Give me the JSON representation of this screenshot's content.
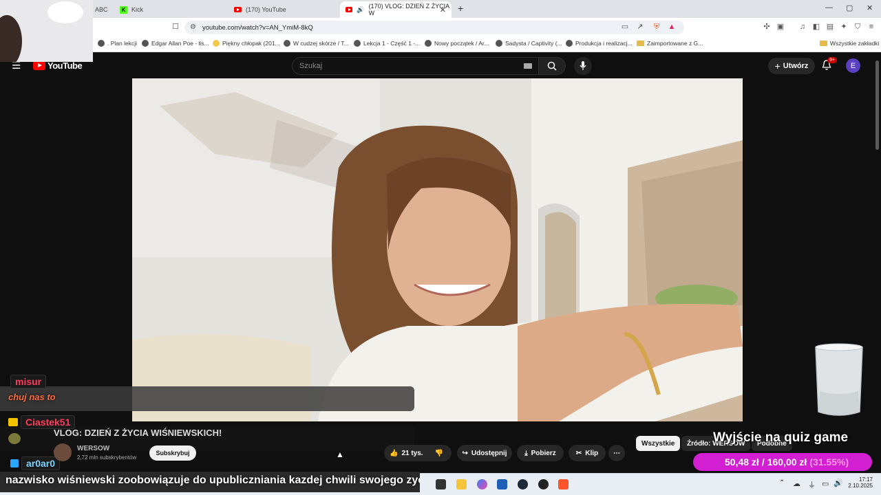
{
  "tabs": [
    {
      "label": "ABC",
      "favicon": "tab-icon"
    },
    {
      "label": "Kick",
      "favicon": "kick-icon"
    },
    {
      "label": "(170) YouTube",
      "favicon": "youtube-icon"
    },
    {
      "label": "(170) VLOG: DZIEŃ Z ŻYCIA W",
      "favicon": "youtube-icon"
    }
  ],
  "new_tab": "+",
  "window_controls": {
    "minimize": "—",
    "maximize": "▢",
    "close": "✕"
  },
  "address": {
    "url": "youtube.com/watch?v=AN_YmiM-8kQ"
  },
  "bookmarks": [
    {
      "label": ". Plan lekcji"
    },
    {
      "label": "Edgar Allan Poe - lis..."
    },
    {
      "label": "Piękny chłopak (201..."
    },
    {
      "label": "W cudzej skórze / T..."
    },
    {
      "label": "Lekcja 1 - Część 1 -..."
    },
    {
      "label": "Nowy początek / Ar..."
    },
    {
      "label": "Sadysta / Captivity (..."
    },
    {
      "label": "Produkcja i realizacj..."
    },
    {
      "label": "Zaimportowane z G..."
    },
    {
      "label": "Wszystkie zakładki"
    }
  ],
  "youtube": {
    "logo": "YouTube",
    "search_placeholder": "Szukaj",
    "create_label": "Utwórz",
    "notif_badge": "9+",
    "avatar_letter": "E"
  },
  "video": {
    "title": "VLOG: DZIEŃ Z ŻYCIA WIŚNIEWSKICH!",
    "channel": "WERSOW",
    "subscribers": "2,72 mln subskrybentów",
    "subscribe_label": "Subskrybuj",
    "likes": "21 tys.",
    "share_label": "Udostępnij",
    "download_label": "Pobierz",
    "clip_label": "Klip",
    "more": "⋯"
  },
  "filters": {
    "all": "Wszystkie",
    "source": "Źródło: WERSOW",
    "related": "Podobne"
  },
  "overlay": {
    "chat": [
      {
        "user": "misur",
        "message": "chuj nas to"
      },
      {
        "user": "Ciastek51",
        "message": ""
      },
      {
        "user": "ar0ar0",
        "message": ""
      }
    ],
    "caption": "nazwisko wiśniewski zoobowiązuje do upubliczniania kazdej chwili swojego zycia",
    "quiz_title": "Wyjście na quiz game",
    "donation": {
      "current": "50,48 zł",
      "sep": "/",
      "goal": "160,00 zł",
      "percent": "(31.55%)"
    }
  },
  "taskbar": {
    "time": "17:17",
    "date": "2.10.2025"
  }
}
